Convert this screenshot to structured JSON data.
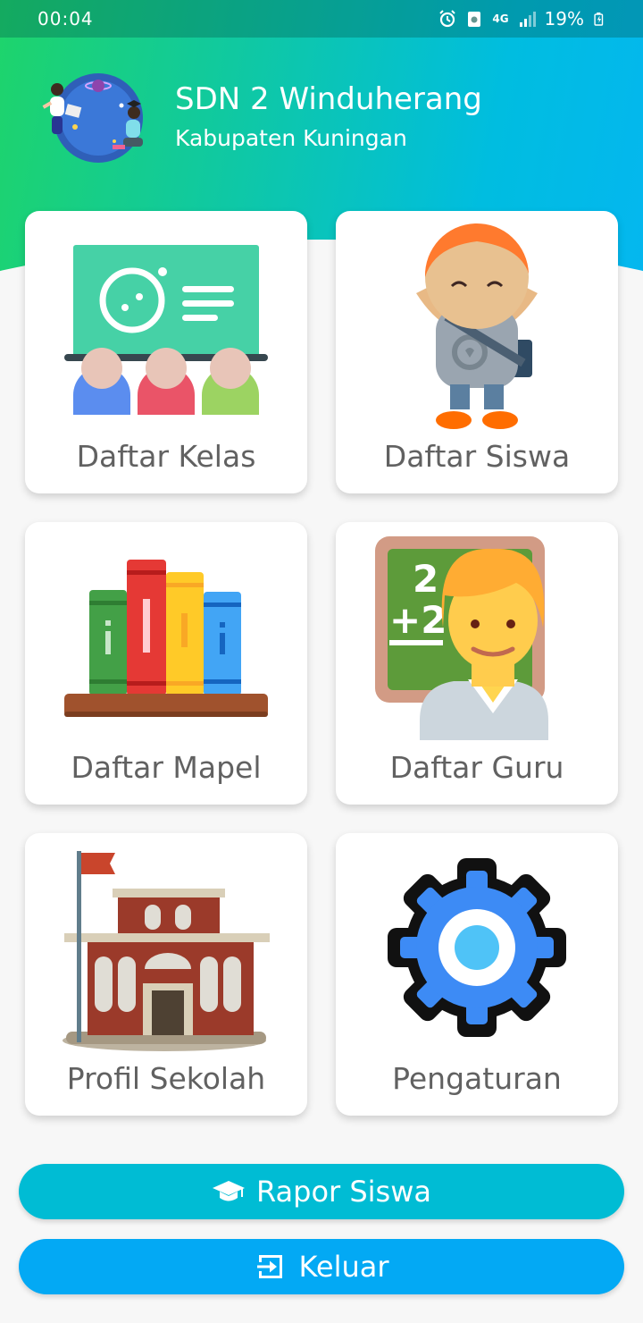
{
  "status_bar": {
    "time": "00:04",
    "network": "4G",
    "battery": "19%"
  },
  "header": {
    "school_name": "SDN 2 Winduherang",
    "region": "Kabupaten Kuningan"
  },
  "menu": {
    "items": [
      {
        "label": "Daftar Kelas",
        "icon": "classroom-icon"
      },
      {
        "label": "Daftar Siswa",
        "icon": "student-icon"
      },
      {
        "label": "Daftar Mapel",
        "icon": "books-icon"
      },
      {
        "label": "Daftar Guru",
        "icon": "teacher-icon"
      },
      {
        "label": "Profil Sekolah",
        "icon": "school-building-icon"
      },
      {
        "label": "Pengaturan",
        "icon": "gear-icon"
      }
    ]
  },
  "actions": {
    "rapor_label": "Rapor Siswa",
    "keluar_label": "Keluar"
  },
  "colors": {
    "header_gradient_start": "#1ed46b",
    "header_gradient_end": "#04b7ef",
    "rapor_button": "#00bcd4",
    "keluar_button": "#03a9f4",
    "card_label": "#616161"
  }
}
